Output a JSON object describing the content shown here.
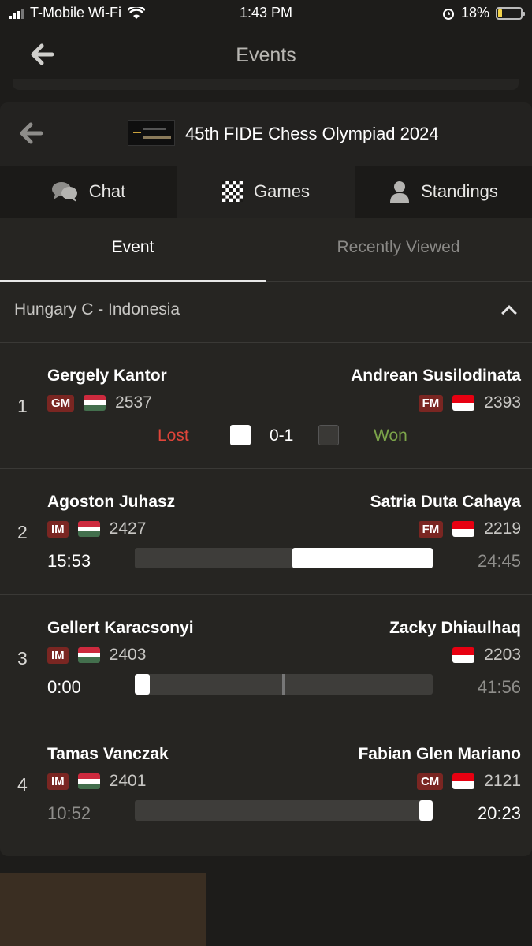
{
  "status_bar": {
    "carrier": "T-Mobile Wi-Fi",
    "time": "1:43 PM",
    "battery": "18%"
  },
  "top_nav": {
    "title": "Events"
  },
  "event": {
    "title": "45th FIDE Chess Olympiad 2024"
  },
  "tabs": [
    {
      "label": "Chat",
      "icon": "chat-icon"
    },
    {
      "label": "Games",
      "icon": "board-icon"
    },
    {
      "label": "Standings",
      "icon": "person-icon"
    }
  ],
  "segments": {
    "event": "Event",
    "recent": "Recently Viewed"
  },
  "match": {
    "label": "Hungary C - Indonesia"
  },
  "games": [
    {
      "board": "1",
      "white": {
        "name": "Gergely Kantor",
        "title": "GM",
        "rating": "2537",
        "flag": "hungary"
      },
      "black": {
        "name": "Andrean Susilodinata",
        "title": "FM",
        "rating": "2393",
        "flag": "indonesia"
      },
      "result": {
        "white_outcome": "Lost",
        "score": "0-1",
        "black_outcome": "Won"
      }
    },
    {
      "board": "2",
      "white": {
        "name": "Agoston Juhasz",
        "title": "IM",
        "rating": "2427",
        "flag": "hungary"
      },
      "black": {
        "name": "Satria Duta Cahaya",
        "title": "FM",
        "rating": "2219",
        "flag": "indonesia"
      },
      "clock": {
        "white": "15:53",
        "black": "24:45",
        "to_move": "white",
        "white_eval_fraction": 0.47
      }
    },
    {
      "board": "3",
      "white": {
        "name": "Gellert Karacsonyi",
        "title": "IM",
        "rating": "2403",
        "flag": "hungary"
      },
      "black": {
        "name": "Zacky Dhiaulhaq",
        "title": "",
        "rating": "2203",
        "flag": "indonesia"
      },
      "clock": {
        "white": "0:00",
        "black": "41:56",
        "to_move": "white",
        "white_eval_fraction": 0.05
      }
    },
    {
      "board": "4",
      "white": {
        "name": "Tamas Vanczak",
        "title": "IM",
        "rating": "2401",
        "flag": "hungary"
      },
      "black": {
        "name": "Fabian Glen Mariano",
        "title": "CM",
        "rating": "2121",
        "flag": "indonesia"
      },
      "clock": {
        "white": "10:52",
        "black": "20:23",
        "to_move": "black",
        "white_eval_fraction": 0.05
      }
    }
  ],
  "colors": {
    "lost": "#e0453a",
    "won": "#7ca54a",
    "title_badge": "#7a2622"
  }
}
